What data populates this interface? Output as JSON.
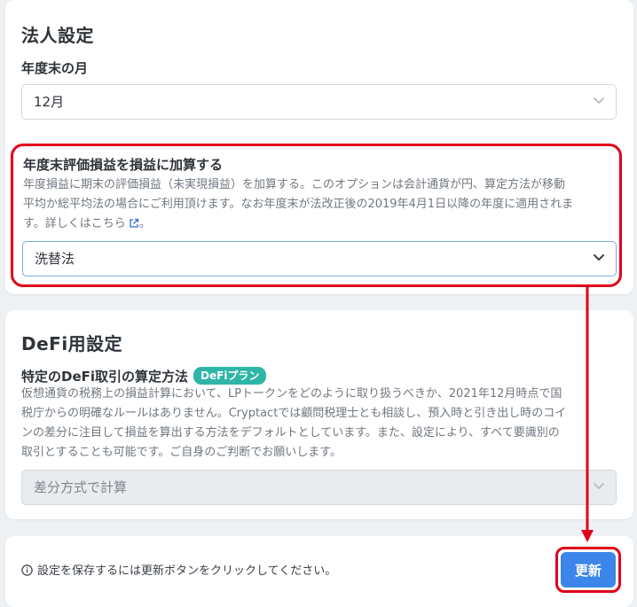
{
  "corporate_settings": {
    "title": "法人設定",
    "fiscal_month_label": "年度末の月",
    "fiscal_month_value": "12月",
    "valuation_label": "年度末評価損益を損益に加算する",
    "valuation_help_1": "年度損益に期末の評価損益（未実現損益）を加算する。このオプションは会計通貨が円、算定方法が移動",
    "valuation_help_2": "平均か総平均法の場合にご利用頂けます。なお年度末が法改正後の2019年4月1日以降の年度に適用されま",
    "valuation_help_3_prefix": "す。詳しくは",
    "valuation_help_link": "こちら",
    "valuation_help_3_suffix": "。",
    "valuation_method_value": "洗替法"
  },
  "defi_settings": {
    "title": "DeFi用設定",
    "calc_method_label": "特定のDeFi取引の算定方法",
    "plan_badge": "DeFiプラン",
    "help_1": "仮想通貨の税務上の損益計算において、LPトークンをどのように取り扱うべきか、2021年12月時点で国",
    "help_2": "税庁からの明確なルールはありません。Cryptactでは顧問税理士とも相談し、預入時と引き出し時のコイ",
    "help_3": "ンの差分に注目して損益を算出する方法をデフォルトとしています。また、設定により、すべて要識別の",
    "help_4": "取引とすることも可能です。ご自身のご判断でお願いします。",
    "calc_method_value": "差分方式で計算"
  },
  "save_bar": {
    "note": "設定を保存するには更新ボタンをクリックしてください。",
    "update_label": "更新"
  },
  "colors": {
    "highlight": "#e0001a",
    "primary_button": "#3b86e8",
    "badge": "#2fb5a8"
  },
  "icons": {
    "select_arrow": "chevron-down-icon",
    "external_link": "external-link-icon",
    "info": "info-icon"
  }
}
